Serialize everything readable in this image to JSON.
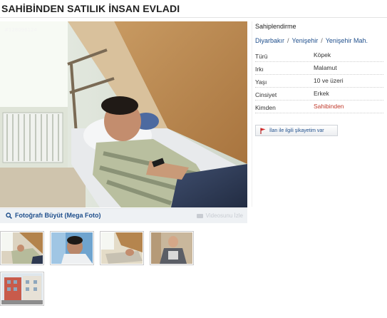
{
  "listing": {
    "title": "SAHİBİNDEN SATILIK İNSAN EVLADI",
    "photo_id": "#128096124"
  },
  "photo_bar": {
    "zoom_label": "Fotoğrafı Büyüt (Mega Foto)",
    "video_label": "Videosunu İzle"
  },
  "details": {
    "category": "Sahiplendirme",
    "location": [
      "Diyarbakır",
      "Yenişehir",
      "Yenişehir Mah."
    ],
    "location_sep": "/",
    "attributes": [
      {
        "key": "Türü",
        "value": "Köpek"
      },
      {
        "key": "Irkı",
        "value": "Malamut"
      },
      {
        "key": "Yaşı",
        "value": "10 ve üzeri"
      },
      {
        "key": "Cinsiyet",
        "value": "Erkek"
      },
      {
        "key": "Kimden",
        "value": "Sahibinden",
        "highlight": true
      }
    ],
    "report_label": "İlan ile ilgili şikayetim var"
  },
  "colors": {
    "link": "#1f4f8c",
    "highlight": "#c0392b"
  }
}
